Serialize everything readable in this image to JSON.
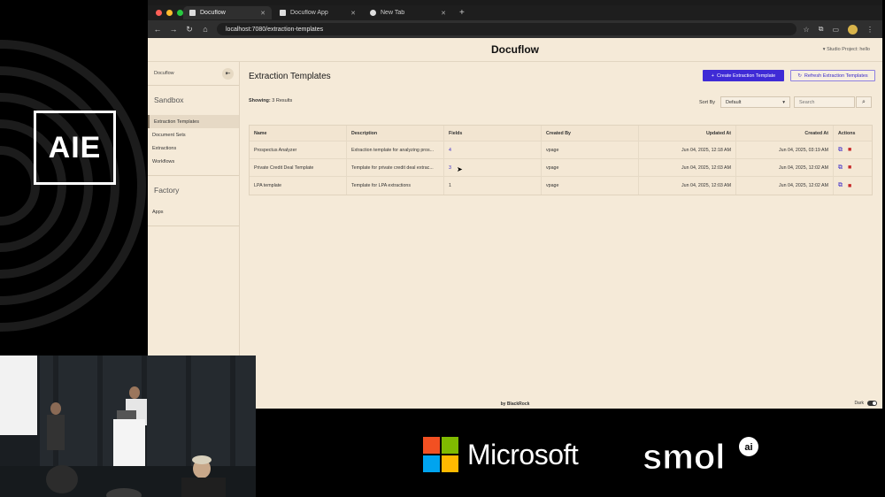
{
  "event_logo": {
    "text": "AIE"
  },
  "browser": {
    "tabs": [
      {
        "label": "Docuflow",
        "active": true
      },
      {
        "label": "Docuflow App",
        "active": false
      },
      {
        "label": "New Tab",
        "active": false
      }
    ],
    "url": "localhost:7080/extraction-templates"
  },
  "app": {
    "title": "Docuflow",
    "studio_project": "Studio Project: hello",
    "footer": "by BlackRock",
    "dark_label": "Dark"
  },
  "sidebar": {
    "brand": "Docuflow",
    "sections": [
      {
        "title": "Sandbox",
        "items": [
          "Extraction Templates",
          "Document Sets",
          "Extractions",
          "Workflows"
        ]
      },
      {
        "title": "Factory",
        "items": [
          "Apps"
        ]
      }
    ],
    "active_item": "Extraction Templates"
  },
  "main": {
    "title": "Extraction Templates",
    "create_button": "Create Extraction Template",
    "refresh_button": "Refresh Extraction Templates",
    "showing_label": "Showing:",
    "showing_value": "3 Results",
    "sort_label": "Sort By",
    "sort_value": "Default",
    "search_placeholder": "Search"
  },
  "table": {
    "headers": [
      "Name",
      "Description",
      "Fields",
      "Created By",
      "Updated At",
      "Created At",
      "Actions"
    ],
    "rows": [
      {
        "name": "Prospectus Analyzer",
        "description": "Extraction template for analyzing pros...",
        "fields": "4",
        "created_by": "vpage",
        "updated_at": "Jun 04, 2025, 12:18 AM",
        "created_at": "Jun 04, 2025, 03:19 AM"
      },
      {
        "name": "Private Credit Deal Template",
        "description": "Template for private credit deal extrac...",
        "fields": "3",
        "created_by": "vpage",
        "updated_at": "Jun 04, 2025, 12:03 AM",
        "created_at": "Jun 04, 2025, 12:02 AM"
      },
      {
        "name": "LPA template",
        "description": "Template for LPA extractions",
        "fields": "1",
        "created_by": "vpage",
        "updated_at": "Jun 04, 2025, 12:03 AM",
        "created_at": "Jun 04, 2025, 12:02 AM"
      }
    ]
  },
  "sponsors": {
    "microsoft": "Microsoft",
    "smol": "smol",
    "smol_badge": "ai"
  },
  "colors": {
    "primary": "#3f2bd6",
    "app_bg": "#f5ead8",
    "delete": "#c62828"
  }
}
